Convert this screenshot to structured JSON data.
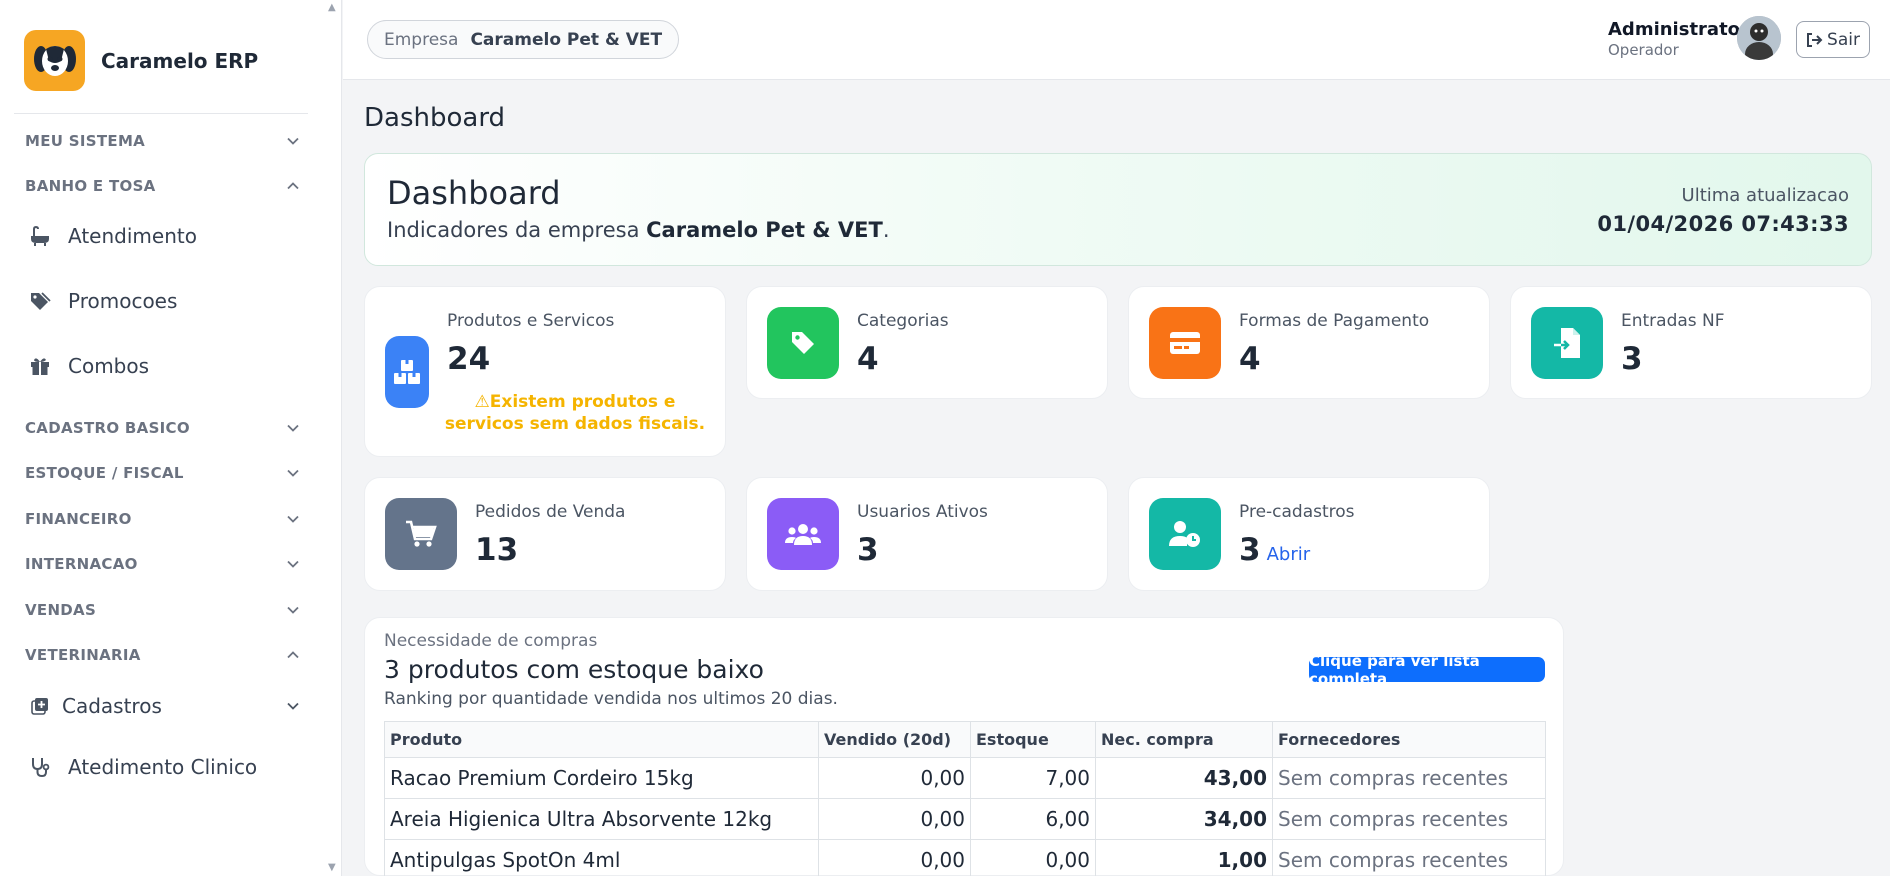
{
  "brand": {
    "name": "Caramelo ERP"
  },
  "sidebar": {
    "sections": [
      {
        "label": "MEU SISTEMA",
        "expanded": false
      },
      {
        "label": "BANHO E TOSA",
        "expanded": true
      },
      {
        "label": "CADASTRO BASICO",
        "expanded": false
      },
      {
        "label": "ESTOQUE / FISCAL",
        "expanded": false
      },
      {
        "label": "FINANCEIRO",
        "expanded": false
      },
      {
        "label": "INTERNACAO",
        "expanded": false
      },
      {
        "label": "VENDAS",
        "expanded": false
      },
      {
        "label": "VETERINARIA",
        "expanded": true
      }
    ],
    "items": [
      {
        "label": "Atendimento",
        "icon": "bath-icon"
      },
      {
        "label": "Promocoes",
        "icon": "tags-icon"
      },
      {
        "label": "Combos",
        "icon": "gift-icon"
      },
      {
        "label": "Cadastros",
        "icon": "plus-square-icon"
      },
      {
        "label": "Atedimento Clinico",
        "icon": "stethoscope-icon"
      }
    ]
  },
  "topbar": {
    "company_label": "Empresa",
    "company_name": "Caramelo Pet & VET",
    "user_name": "Administrator",
    "user_role": "Operador",
    "logout_label": "Sair"
  },
  "page": {
    "title": "Dashboard"
  },
  "hero": {
    "title": "Dashboard",
    "subtitle_prefix": "Indicadores da empresa ",
    "company": "Caramelo Pet & VET",
    "subtitle_suffix": ".",
    "update_label": "Ultima atualizacao",
    "update_value": "01/04/2026 07:43:33"
  },
  "cards": [
    {
      "label": "Produtos e Servicos",
      "value": "24",
      "color": "#3b82f6",
      "icon": "boxes-icon",
      "warning": "Existem produtos e servicos sem dados fiscais."
    },
    {
      "label": "Categorias",
      "value": "4",
      "color": "#22c55e",
      "icon": "tag-icon"
    },
    {
      "label": "Formas de Pagamento",
      "value": "4",
      "color": "#f97316",
      "icon": "credit-card-icon"
    },
    {
      "label": "Entradas NF",
      "value": "3",
      "color": "#14b8a6",
      "icon": "file-import-icon"
    },
    {
      "label": "Pedidos de Venda",
      "value": "13",
      "color": "#64748b",
      "icon": "cart-icon"
    },
    {
      "label": "Usuarios Ativos",
      "value": "3",
      "color": "#8b5cf6",
      "icon": "users-icon"
    },
    {
      "label": "Pre-cadastros",
      "value": "3",
      "color": "#14b8a6",
      "icon": "user-clock-icon",
      "link": "Abrir"
    }
  ],
  "purchases": {
    "kicker": "Necessidade de compras",
    "title": "3 produtos com estoque baixo",
    "subtitle": "Ranking por quantidade vendida nos ultimos 20 dias.",
    "button": "Clique para ver lista completa",
    "columns": [
      "Produto",
      "Vendido (20d)",
      "Estoque",
      "Nec. compra",
      "Fornecedores"
    ],
    "rows": [
      [
        "Racao Premium Cordeiro 15kg",
        "0,00",
        "7,00",
        "43,00",
        "Sem compras recentes"
      ],
      [
        "Areia Higienica Ultra Absorvente 12kg",
        "0,00",
        "6,00",
        "34,00",
        "Sem compras recentes"
      ],
      [
        "Antipulgas SpotOn 4ml",
        "0,00",
        "0,00",
        "1,00",
        "Sem compras recentes"
      ]
    ]
  }
}
